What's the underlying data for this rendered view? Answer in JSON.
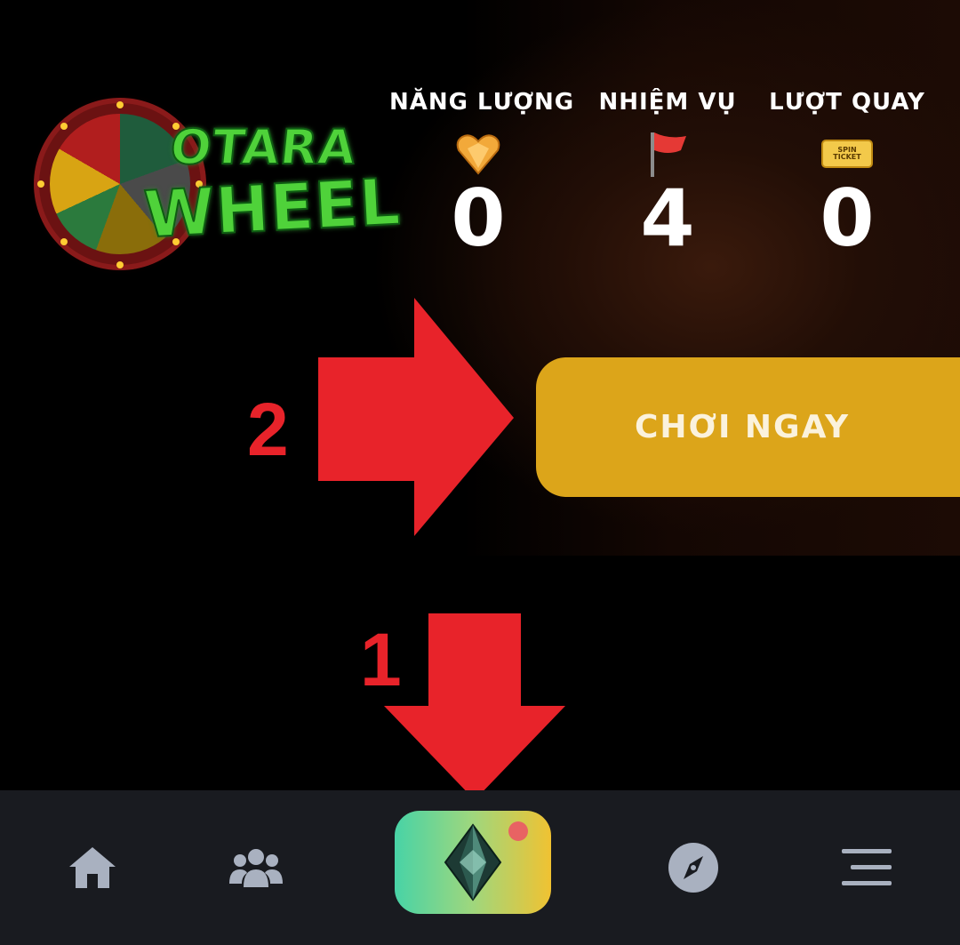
{
  "logo": {
    "line1": "OTARA",
    "line2": "WHEEL"
  },
  "stats": [
    {
      "label": "NĂNG LƯỢNG",
      "value": "0",
      "icon": "gem-heart-icon"
    },
    {
      "label": "NHIỆM VỤ",
      "value": "4",
      "icon": "flag-icon"
    },
    {
      "label": "LƯỢT QUAY",
      "value": "0",
      "icon": "spin-ticket-icon",
      "icon_text": "SPIN TICKET"
    }
  ],
  "play_button": {
    "label": "CHƠI NGAY"
  },
  "annotations": {
    "step1": "1",
    "step2": "2"
  },
  "bottom_nav": [
    {
      "name": "home",
      "icon": "home-icon"
    },
    {
      "name": "community",
      "icon": "group-icon"
    },
    {
      "name": "otara",
      "icon": "crystal-icon",
      "has_notification": true
    },
    {
      "name": "explore",
      "icon": "compass-icon"
    },
    {
      "name": "menu",
      "icon": "menu-icon"
    }
  ],
  "colors": {
    "button_gold": "#dca51a",
    "annotation_red": "#e8232a",
    "nav_background": "#191b20",
    "nav_icon": "#a9b1c0",
    "notification": "#e86363"
  }
}
